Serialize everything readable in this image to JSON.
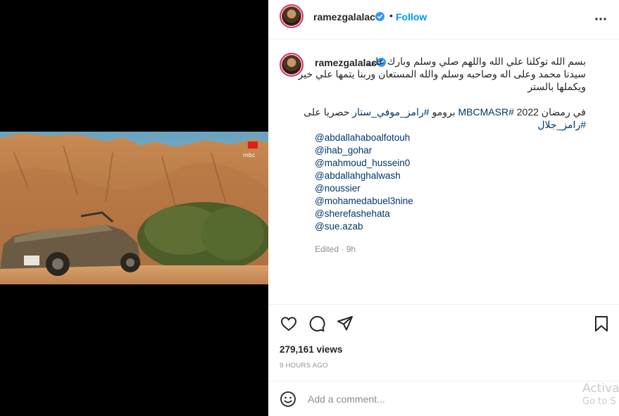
{
  "post": {
    "username": "ramezgalalac",
    "follow_label": "Follow",
    "dot": "•",
    "caption_ar_line1": "بسم الله توكلنا علي الله واللهم صلي وسلم وبارك على",
    "caption_ar_line2": "سيدنا محمد وعلى اله وصاحبه وسلم والله المستعان وربنا يتمها علي خير",
    "caption_ar_line3": "ويكملها بالستر",
    "promo_text_before": "في رمضان 2022 ",
    "promo_hashtag1": "#MBCMASR",
    "promo_text_mid": " برومو ",
    "promo_hashtag2": "#رامز_موفي_ستار",
    "promo_text_after": " حصريا على",
    "promo_hashtag3": "#رامز_جلال",
    "mentions": [
      "@abdallahaboalfotouh",
      "@ihab_gohar",
      "@mahmoud_hussein0",
      "@abdallahghalwash",
      "@noussier",
      "@mohamedabuel3nine",
      "@sherefashehata",
      "@sue.azab"
    ],
    "edited_time": "Edited · 9h",
    "views": "279,161 views",
    "post_time": "9 HOURS AGO",
    "comment_placeholder": "Add a comment..."
  },
  "media": {
    "channel_logo_text": "mbc"
  },
  "watermark": {
    "title": "Activa",
    "subtitle": "Go to S"
  },
  "colors": {
    "accent": "#0095f6",
    "link": "#00376b",
    "text": "#262626",
    "muted": "#8e8e8e"
  }
}
